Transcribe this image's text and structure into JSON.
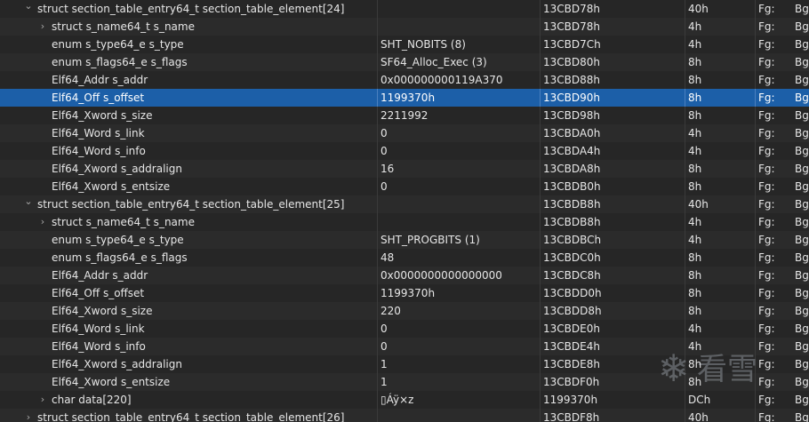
{
  "table": {
    "rows": [
      {
        "depth": 0,
        "expander": "expanded",
        "name": "struct section_table_entry64_t section_table_element[24]",
        "value": "",
        "start": "13CBD78h",
        "size": "40h",
        "fg": "Fg:",
        "bg": "Bg"
      },
      {
        "depth": 1,
        "expander": "collapsed",
        "name": "struct s_name64_t s_name",
        "value": "",
        "start": "13CBD78h",
        "size": "4h",
        "fg": "Fg:",
        "bg": "Bg"
      },
      {
        "depth": 1,
        "expander": "none",
        "name": "enum s_type64_e s_type",
        "value": "SHT_NOBITS (8)",
        "start": "13CBD7Ch",
        "size": "4h",
        "fg": "Fg:",
        "bg": "Bg"
      },
      {
        "depth": 1,
        "expander": "none",
        "name": "enum s_flags64_e s_flags",
        "value": "SF64_Alloc_Exec (3)",
        "start": "13CBD80h",
        "size": "8h",
        "fg": "Fg:",
        "bg": "Bg"
      },
      {
        "depth": 1,
        "expander": "none",
        "name": "Elf64_Addr s_addr",
        "value": "0x000000000119A370",
        "start": "13CBD88h",
        "size": "8h",
        "fg": "Fg:",
        "bg": "Bg"
      },
      {
        "depth": 1,
        "expander": "none",
        "name": "Elf64_Off s_offset",
        "value": "1199370h",
        "start": "13CBD90h",
        "size": "8h",
        "fg": "Fg:",
        "bg": "Bg",
        "selected": true
      },
      {
        "depth": 1,
        "expander": "none",
        "name": "Elf64_Xword s_size",
        "value": "2211992",
        "start": "13CBD98h",
        "size": "8h",
        "fg": "Fg:",
        "bg": "Bg"
      },
      {
        "depth": 1,
        "expander": "none",
        "name": "Elf64_Word s_link",
        "value": "0",
        "start": "13CBDA0h",
        "size": "4h",
        "fg": "Fg:",
        "bg": "Bg"
      },
      {
        "depth": 1,
        "expander": "none",
        "name": "Elf64_Word s_info",
        "value": "0",
        "start": "13CBDA4h",
        "size": "4h",
        "fg": "Fg:",
        "bg": "Bg"
      },
      {
        "depth": 1,
        "expander": "none",
        "name": "Elf64_Xword s_addralign",
        "value": "16",
        "start": "13CBDA8h",
        "size": "8h",
        "fg": "Fg:",
        "bg": "Bg"
      },
      {
        "depth": 1,
        "expander": "none",
        "name": "Elf64_Xword s_entsize",
        "value": "0",
        "start": "13CBDB0h",
        "size": "8h",
        "fg": "Fg:",
        "bg": "Bg"
      },
      {
        "depth": 0,
        "expander": "expanded",
        "name": "struct section_table_entry64_t section_table_element[25]",
        "value": "",
        "start": "13CBDB8h",
        "size": "40h",
        "fg": "Fg:",
        "bg": "Bg"
      },
      {
        "depth": 1,
        "expander": "collapsed",
        "name": "struct s_name64_t s_name",
        "value": "",
        "start": "13CBDB8h",
        "size": "4h",
        "fg": "Fg:",
        "bg": "Bg"
      },
      {
        "depth": 1,
        "expander": "none",
        "name": "enum s_type64_e s_type",
        "value": "SHT_PROGBITS (1)",
        "start": "13CBDBCh",
        "size": "4h",
        "fg": "Fg:",
        "bg": "Bg"
      },
      {
        "depth": 1,
        "expander": "none",
        "name": "enum s_flags64_e s_flags",
        "value": "48",
        "start": "13CBDC0h",
        "size": "8h",
        "fg": "Fg:",
        "bg": "Bg"
      },
      {
        "depth": 1,
        "expander": "none",
        "name": "Elf64_Addr s_addr",
        "value": "0x0000000000000000",
        "start": "13CBDC8h",
        "size": "8h",
        "fg": "Fg:",
        "bg": "Bg"
      },
      {
        "depth": 1,
        "expander": "none",
        "name": "Elf64_Off s_offset",
        "value": "1199370h",
        "start": "13CBDD0h",
        "size": "8h",
        "fg": "Fg:",
        "bg": "Bg"
      },
      {
        "depth": 1,
        "expander": "none",
        "name": "Elf64_Xword s_size",
        "value": "220",
        "start": "13CBDD8h",
        "size": "8h",
        "fg": "Fg:",
        "bg": "Bg"
      },
      {
        "depth": 1,
        "expander": "none",
        "name": "Elf64_Word s_link",
        "value": "0",
        "start": "13CBDE0h",
        "size": "4h",
        "fg": "Fg:",
        "bg": "Bg"
      },
      {
        "depth": 1,
        "expander": "none",
        "name": "Elf64_Word s_info",
        "value": "0",
        "start": "13CBDE4h",
        "size": "4h",
        "fg": "Fg:",
        "bg": "Bg"
      },
      {
        "depth": 1,
        "expander": "none",
        "name": "Elf64_Xword s_addralign",
        "value": "1",
        "start": "13CBDE8h",
        "size": "8h",
        "fg": "Fg:",
        "bg": "Bg"
      },
      {
        "depth": 1,
        "expander": "none",
        "name": "Elf64_Xword s_entsize",
        "value": "1",
        "start": "13CBDF0h",
        "size": "8h",
        "fg": "Fg:",
        "bg": "Bg"
      },
      {
        "depth": 1,
        "expander": "collapsed",
        "name": "char data[220]",
        "value": "▯Áÿ×z",
        "start": "1199370h",
        "size": "DCh",
        "fg": "Fg:",
        "bg": "Bg"
      },
      {
        "depth": 0,
        "expander": "collapsed",
        "name": "struct section_table_entry64_t section_table_element[26]",
        "value": "",
        "start": "13CBDF8h",
        "size": "40h",
        "fg": "Fg:",
        "bg": "Bg"
      }
    ]
  },
  "icons": {
    "expanded": "chevron-down-icon",
    "collapsed": "chevron-right-icon"
  },
  "watermark": {
    "text": "看雪",
    "icon": "snowflake-icon"
  },
  "colors": {
    "background": "#262626",
    "row_alt": "#2b2b2b",
    "selection": "#1c5fa8",
    "text": "#e6e6e6"
  }
}
